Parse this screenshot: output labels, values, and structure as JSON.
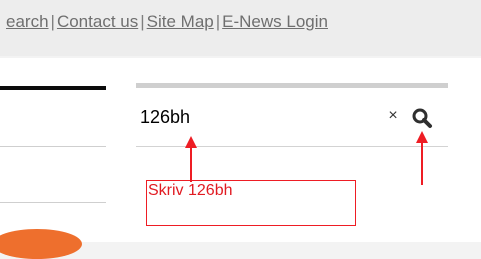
{
  "header": {
    "links": [
      "earch",
      "Contact us",
      "Site Map",
      "E-News Login"
    ],
    "separator": "|"
  },
  "search": {
    "value": "126bh",
    "clear_label": "×",
    "search_icon": "search-icon"
  },
  "annotation": {
    "text": "Skriv 126bh",
    "color": "#e11b22"
  }
}
